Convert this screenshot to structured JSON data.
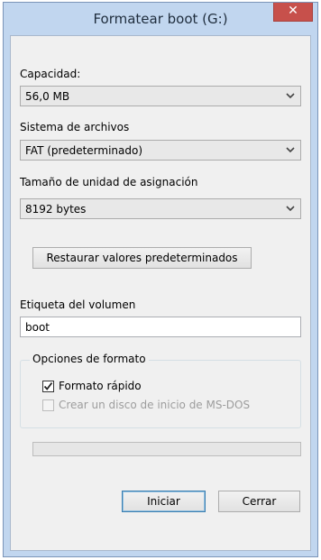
{
  "window": {
    "title": "Formatear boot (G:)",
    "close_glyph": "✕"
  },
  "capacity": {
    "label": "Capacidad:",
    "value": "56,0 MB"
  },
  "filesystem": {
    "label": "Sistema de archivos",
    "value": "FAT (predeterminado)"
  },
  "allocation": {
    "label": "Tamaño de unidad de asignación",
    "value": "8192 bytes"
  },
  "restore_button": {
    "label": "Restaurar valores predeterminados"
  },
  "volume": {
    "label": "Etiqueta del volumen",
    "value": "boot"
  },
  "format_options": {
    "title": "Opciones de formato",
    "quick_format": {
      "label": "Formato rápido",
      "checked": true,
      "enabled": true
    },
    "msdos_disk": {
      "label": "Crear un disco de inicio de MS-DOS",
      "checked": false,
      "enabled": false
    }
  },
  "progress": {
    "value": 0
  },
  "buttons": {
    "start": "Iniciar",
    "close": "Cerrar"
  },
  "icons": {
    "dropdown": "chevron-down-icon",
    "check": "check-icon",
    "close": "close-icon"
  },
  "colors": {
    "titlebar": "#c1d6ef",
    "close": "#c7504b",
    "dialog": "#f0f0f0",
    "default_border": "#3c7fb1"
  }
}
